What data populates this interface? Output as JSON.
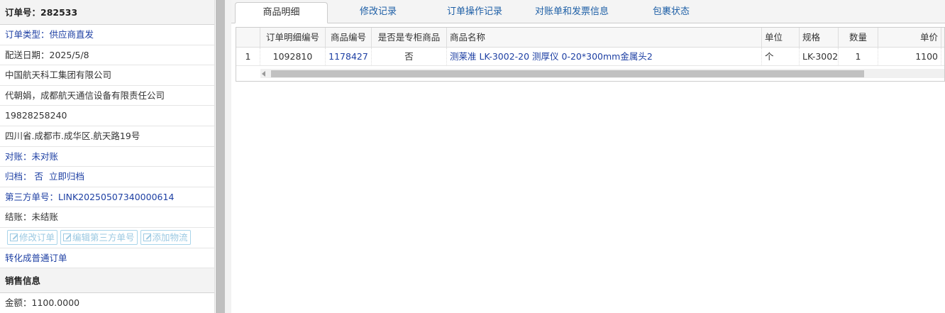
{
  "order": {
    "number_label": "订单号：282533",
    "type": "订单类型：供应商直发",
    "delivery_date": "配送日期：2025/5/8",
    "company": "中国航天科工集团有限公司",
    "contact": "代朝娟，成都航天通信设备有限责任公司",
    "phone": "19828258240",
    "address": "四川省.成都市.成华区.航天路19号",
    "reconcile": "对账：未对账",
    "archive_label": "归档：",
    "archive_value": "否",
    "archive_action": "立即归档",
    "third_party": "第三方单号：LINK20250507340000614",
    "settlement": "结账：未结账",
    "buttons": {
      "edit_order": "修改订单",
      "edit_third_party": "编辑第三方单号",
      "add_logistics": "添加物流"
    },
    "convert": "转化成普通订单"
  },
  "sales": {
    "header": "销售信息",
    "amount": "金额：1100.0000"
  },
  "tabs": [
    {
      "label": "商品明细",
      "active": true
    },
    {
      "label": "修改记录"
    },
    {
      "label": "订单操作记录"
    },
    {
      "label": "对账单和发票信息"
    },
    {
      "label": "包裹状态"
    }
  ],
  "grid": {
    "columns": [
      "订单明细编号",
      "商品编号",
      "是否是专柜商品",
      "商品名称",
      "单位",
      "规格",
      "数量",
      "单价"
    ],
    "rows": [
      {
        "index": "1",
        "detail_id": "1092810",
        "product_id": "1178427",
        "is_counter": "否",
        "name": "测莱准 LK-3002-20 测厚仪 0-20*300mm金属头2",
        "unit": "个",
        "spec": "LK-3002",
        "qty": "1",
        "price": "1100"
      }
    ]
  }
}
